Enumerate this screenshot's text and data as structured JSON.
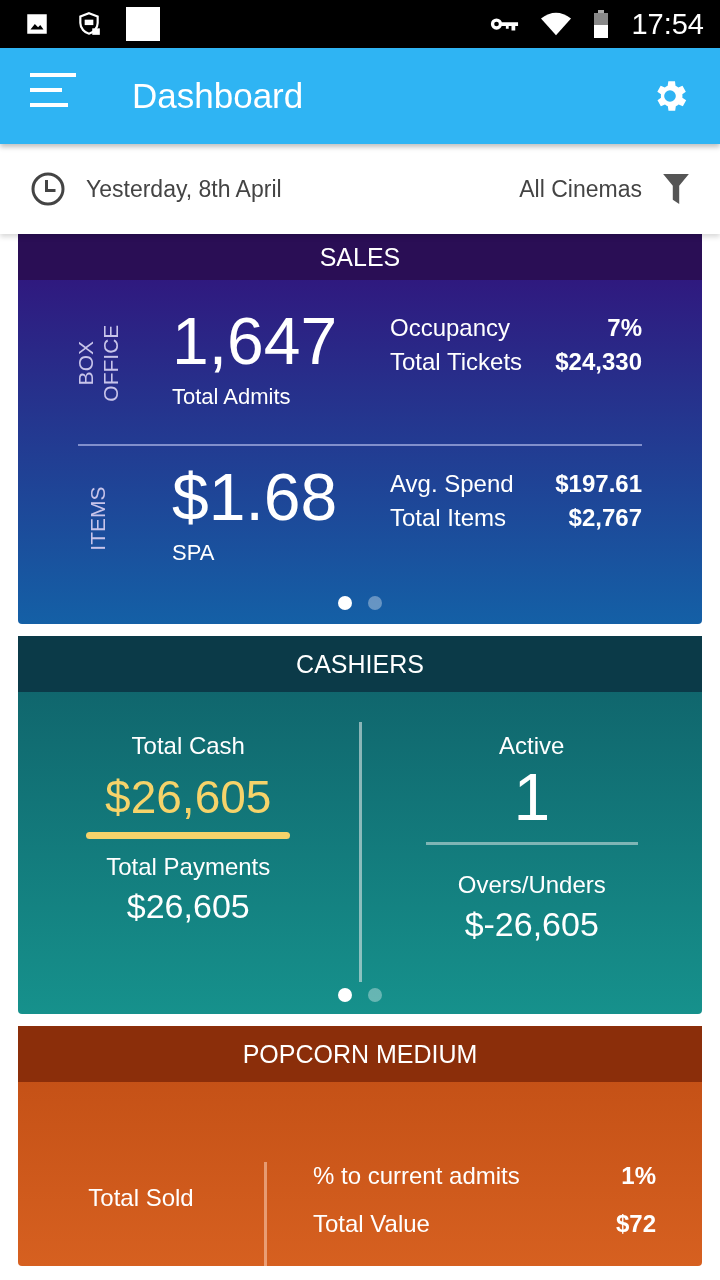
{
  "status_bar": {
    "time": "17:54"
  },
  "app_bar": {
    "title": "Dashboard"
  },
  "filter_bar": {
    "date": "Yesterday, 8th April",
    "cinema": "All Cinemas"
  },
  "sales": {
    "title": "SALES",
    "sections": [
      {
        "side_label": "BOX OFFICE",
        "big_value": "1,647",
        "caption": "Total Admits",
        "stats": [
          {
            "label": "Occupancy",
            "value": "7%"
          },
          {
            "label": "Total Tickets",
            "value": "$24,330"
          }
        ]
      },
      {
        "side_label": "ITEMS",
        "big_value": "$1.68",
        "caption": "SPA",
        "stats": [
          {
            "label": "Avg. Spend",
            "value": "$197.61"
          },
          {
            "label": "Total Items",
            "value": "$2,767"
          }
        ]
      }
    ],
    "pages": [
      {
        "selected": true
      },
      {
        "selected": false
      }
    ]
  },
  "cashiers": {
    "title": "CASHIERS",
    "left": {
      "label": "Total Cash",
      "value": "$26,605",
      "label2": "Total Payments",
      "value2": "$26,605"
    },
    "right": {
      "label": "Active",
      "value": "1",
      "label2": "Overs/Unders",
      "value2": "$-26,605"
    },
    "pages": [
      {
        "selected": true
      },
      {
        "selected": false
      }
    ]
  },
  "popcorn": {
    "title": "POPCORN MEDIUM",
    "left_label": "Total Sold",
    "stats": [
      {
        "label": "% to current admits",
        "value": "1%"
      },
      {
        "label": "Total Value",
        "value": "$72"
      }
    ]
  }
}
